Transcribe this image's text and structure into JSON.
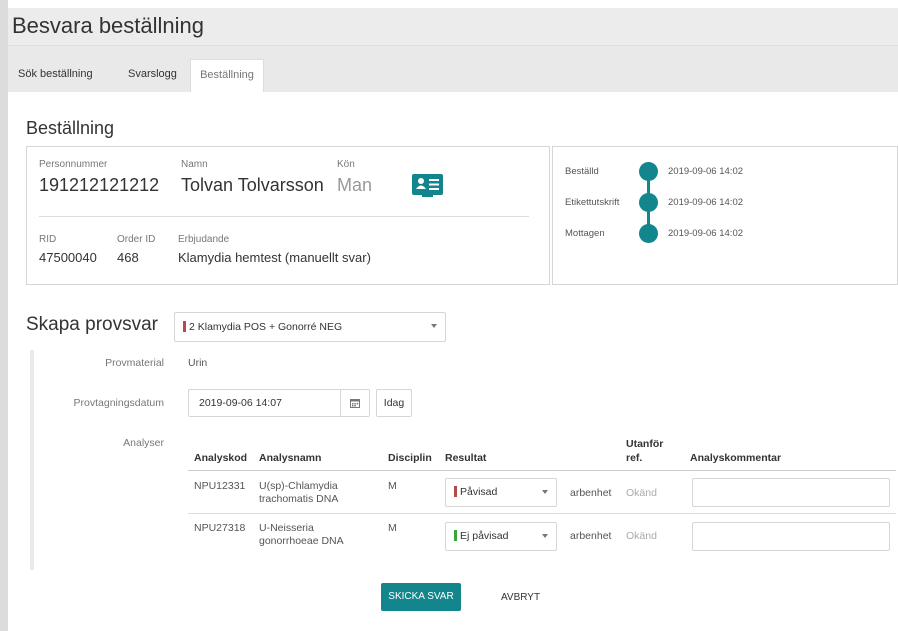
{
  "header": {
    "title": "Besvara beställning"
  },
  "tabs": [
    {
      "label": "Sök beställning"
    },
    {
      "label": "Svarslogg"
    },
    {
      "label": "Beställning"
    }
  ],
  "order": {
    "title": "Beställning",
    "personnummer_label": "Personnummer",
    "personnummer": "191212121212",
    "namn_label": "Namn",
    "namn": "Tolvan Tolvarsson",
    "kon_label": "Kön",
    "kon": "Man",
    "rid_label": "RID",
    "rid": "47500040",
    "order_id_label": "Order ID",
    "order_id": "468",
    "erbjudande_label": "Erbjudande",
    "erbjudande": "Klamydia hemtest (manuellt svar)"
  },
  "timeline": [
    {
      "label": "Beställd",
      "time": "2019-09-06 14:02"
    },
    {
      "label": "Etikettutskrift",
      "time": "2019-09-06 14:02"
    },
    {
      "label": "Mottagen",
      "time": "2019-09-06 14:02"
    }
  ],
  "provsvar": {
    "title": "Skapa provsvar",
    "template_select": "2 Klamydia POS + Gonorré NEG",
    "provmaterial_label": "Provmaterial",
    "provmaterial": "Urin",
    "datum_label": "Provtagningsdatum",
    "datum": "2019-09-06 14:07",
    "idag_label": "Idag",
    "analyser_label": "Analyser"
  },
  "table": {
    "headers": {
      "analyskod": "Analyskod",
      "analysnamn": "Analysnamn",
      "disciplin": "Disciplin",
      "resultat": "Resultat",
      "utanfor_1": "Utanför",
      "utanfor_2": "ref.",
      "kommentar": "Analyskommentar"
    },
    "rows": [
      {
        "kod": "NPU12331",
        "namn_1": "U(sp)-Chlamydia",
        "namn_2": "trachomatis DNA",
        "disciplin": "M",
        "resultat": "Påvisad",
        "enhet": "arbenhet",
        "utanfor": "Okänd",
        "kommentar": ""
      },
      {
        "kod": "NPU27318",
        "namn_1": "U-Neisseria",
        "namn_2": "gonorrhoeae DNA",
        "disciplin": "M",
        "resultat": "Ej påvisad",
        "enhet": "arbenhet",
        "utanfor": "Okänd",
        "kommentar": ""
      }
    ]
  },
  "actions": {
    "submit": "SKICKA SVAR",
    "cancel": "AVBRYT"
  },
  "colors": {
    "accent": "#13868d",
    "positive": "#b34a4a",
    "negative": "#3aa63a"
  },
  "icons": {
    "patient": "id-card-icon",
    "calendar": "calendar-icon",
    "dropdown": "chevron-down-icon"
  }
}
